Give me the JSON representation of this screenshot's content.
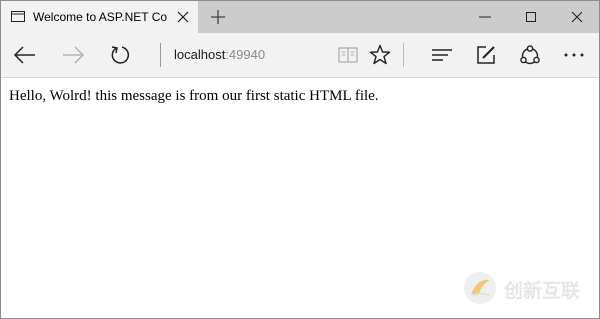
{
  "tab": {
    "title": "Welcome to ASP.NET Co",
    "page_icon": "page-icon",
    "close_icon": "close-icon"
  },
  "titlebar": {
    "new_tab_icon": "plus-icon",
    "minimize_icon": "minimize-icon",
    "maximize_icon": "maximize-icon",
    "close_icon": "close-icon"
  },
  "toolbar": {
    "back_icon": "arrow-left-icon",
    "forward_icon": "arrow-right-icon",
    "refresh_icon": "refresh-icon",
    "address": {
      "host": "localhost",
      "port": ":49940"
    },
    "reading_view_icon": "book-icon",
    "favorite_icon": "star-icon",
    "hub_icon": "hub-icon",
    "web_note_icon": "pen-icon",
    "share_icon": "share-icon",
    "more_icon": "more-icon"
  },
  "page": {
    "message": "Hello, Wolrd! this message is from our first static HTML file."
  },
  "watermark": {
    "text": "创新互联"
  },
  "colors": {
    "titlebar": "#cccccc",
    "tab_active": "#f2f2f2",
    "toolbar": "#f2f2f2",
    "port_text": "#8a8a8a",
    "forward_disabled": "#b3b3b3",
    "watermark": "#e6e6e6"
  }
}
